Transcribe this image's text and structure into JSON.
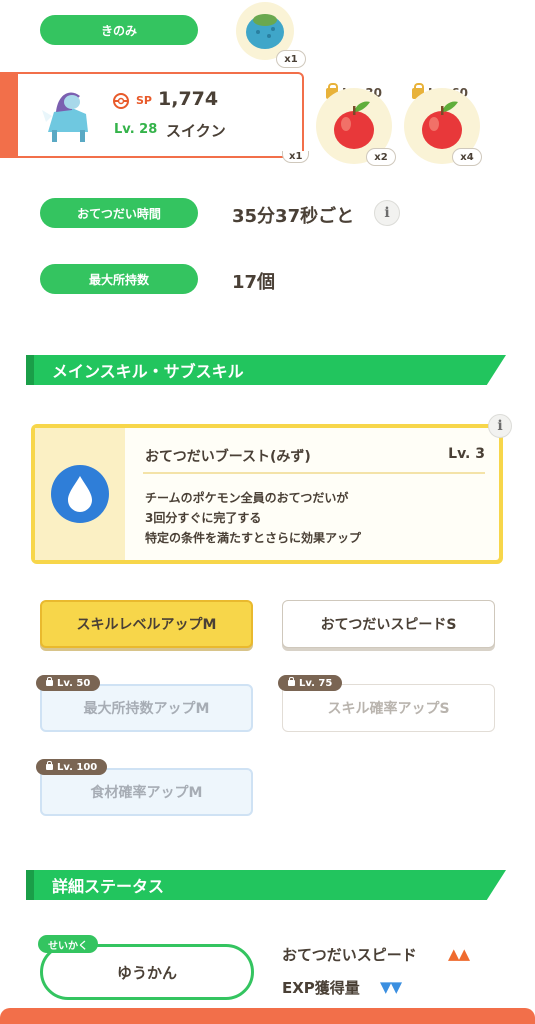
{
  "berry": {
    "label": "きのみ",
    "count": "x1"
  },
  "pokemon_card": {
    "sp_label": "SP",
    "sp_value": "1,774",
    "level": "Lv. 28",
    "name": "スイクン",
    "hidden_count": "x1"
  },
  "ingredients": [
    {
      "unlock": "Lv. 30",
      "count": "x2"
    },
    {
      "unlock": "Lv. 60",
      "count": "x4"
    }
  ],
  "help_time": {
    "label": "おてつだい時間",
    "value": "35分37秒ごと"
  },
  "max_carry": {
    "label": "最大所持数",
    "value": "17個"
  },
  "skills_section": {
    "title": "メインスキル・サブスキル"
  },
  "main_skill": {
    "name": "おてつだいブースト(みず)",
    "level": "Lv. 3",
    "desc_line1": "チームのポケモン全員のおてつだいが",
    "desc_line2": "3回分すぐに完了する",
    "desc_line3": "特定の条件を満たすとさらに効果アップ"
  },
  "sub_skills": [
    {
      "label": "スキルレベルアップM",
      "unlock": ""
    },
    {
      "label": "おてつだいスピードS",
      "unlock": ""
    },
    {
      "label": "最大所持数アップM",
      "unlock": "Lv. 50"
    },
    {
      "label": "スキル確率アップS",
      "unlock": "Lv. 75"
    },
    {
      "label": "食材確率アップM",
      "unlock": "Lv. 100"
    }
  ],
  "details_section": {
    "title": "詳細ステータス"
  },
  "nature": {
    "tag": "せいかく",
    "value": "ゆうかん",
    "up_label": "おてつだいスピード",
    "up_marks": "▲▲",
    "down_label": "EXP獲得量",
    "down_marks": "▼▼"
  },
  "colors": {
    "accent_green": "#22c55e",
    "pill_green": "#34c460",
    "skill_yellow": "#f7d64a",
    "up_orange": "#ef6b2f",
    "down_blue": "#3b8fe0",
    "card_orange": "#f26f4a"
  }
}
